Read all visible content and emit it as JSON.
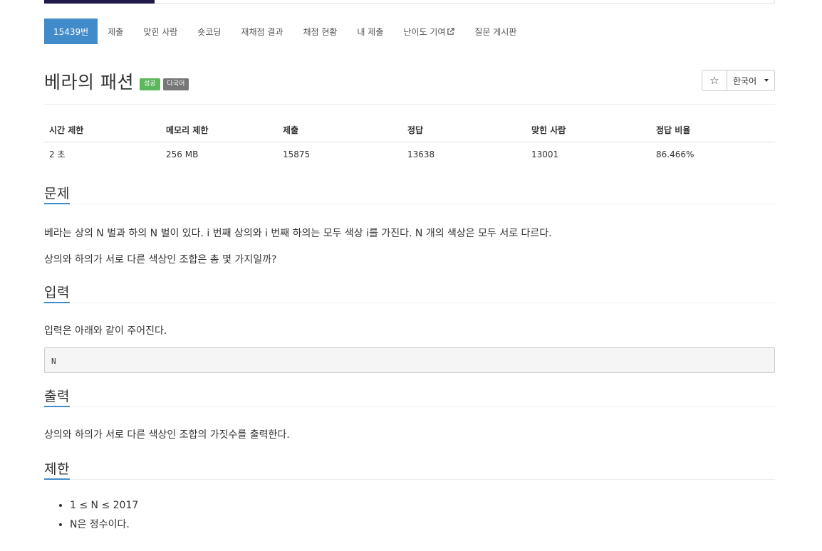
{
  "nav": {
    "problem_id": "15439번",
    "items": [
      "제출",
      "맞힌 사람",
      "숏코딩",
      "재채점 결과",
      "채점 현황",
      "내 제출",
      "난이도 기여",
      "질문 게시판"
    ]
  },
  "title": {
    "text": "베라의 패션",
    "badge_success": "성공",
    "badge_multilang": "다국어"
  },
  "buttons": {
    "star_icon": "☆",
    "language": "한국어"
  },
  "stats": {
    "headers": [
      "시간 제한",
      "메모리 제한",
      "제출",
      "정답",
      "맞힌 사람",
      "정답 비율"
    ],
    "values": [
      "2 초",
      "256 MB",
      "15875",
      "13638",
      "13001",
      "86.466%"
    ]
  },
  "problem": {
    "title": "문제",
    "p1": "베라는 상의 N 벌과 하의 N 벌이 있다. i 번째 상의와 i 번째 하의는 모두 색상 i를 가진다. N 개의 색상은 모두 서로 다르다.",
    "p2": "상의와 하의가 서로 다른 색상인 조합은 총 몇 가지일까?"
  },
  "input": {
    "title": "입력",
    "text": "입력은 아래와 같이 주어진다.",
    "format": "N"
  },
  "output": {
    "title": "출력",
    "text": "상의와 하의가 서로 다른 색상인 조합의 가짓수를 출력한다."
  },
  "limits": {
    "title": "제한",
    "items": [
      "1 ≤ N ≤ 2017",
      "N은 정수이다."
    ]
  },
  "colors": {
    "accent": "#428bca",
    "success": "#5cb85c",
    "default_label": "#777777"
  }
}
